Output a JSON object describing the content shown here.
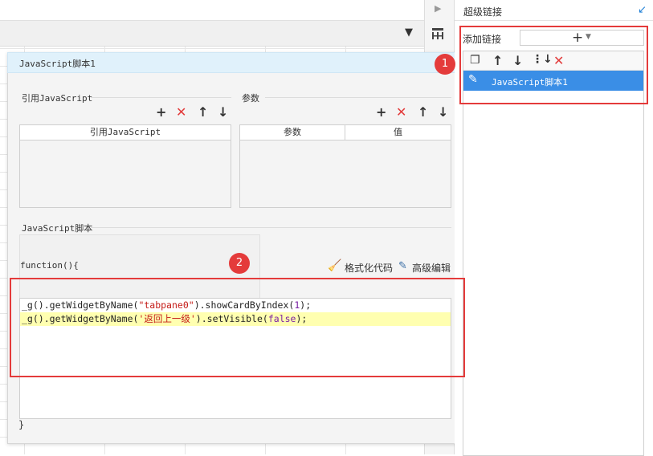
{
  "right_panel": {
    "title": "超级链接",
    "add_link_label": "添加链接",
    "items": [
      {
        "label": "JavaScript脚本1",
        "selected": true
      }
    ]
  },
  "dialog": {
    "title": "JavaScript脚本1",
    "ref_section_title": "引用JavaScript",
    "ref_table_header": "引用JavaScript",
    "param_section_title": "参数",
    "param_headers": [
      "参数",
      "值"
    ],
    "script_section_title": "JavaScript脚本",
    "function_open": "function(){",
    "format_code_label": "格式化代码",
    "advanced_edit_label": "高级编辑",
    "code": {
      "line1": {
        "a": "_g",
        "b": "().",
        "c": "getWidgetByName",
        "d": "(",
        "e": "\"tabpane0\"",
        "f": ").",
        "g": "showCardByIndex",
        "h": "(",
        "i": "1",
        "j": ");"
      },
      "line2": {
        "a": "_g",
        "b": "().",
        "c": "getWidgetByName",
        "d": "(",
        "e": "'返回上一级'",
        "f": ").",
        "g": "setVisible",
        "h": "(",
        "i": "false",
        "j": ");"
      }
    },
    "function_close": "}"
  },
  "annotations": [
    "1",
    "2"
  ],
  "icons": {
    "add": "+",
    "delete": "✕",
    "up": "↑",
    "down": "↓"
  },
  "colors": {
    "accent": "#3a8ee6",
    "annotation": "#e43b3b",
    "delete": "#e23b3b",
    "title_bg": "#e0f1fb"
  }
}
